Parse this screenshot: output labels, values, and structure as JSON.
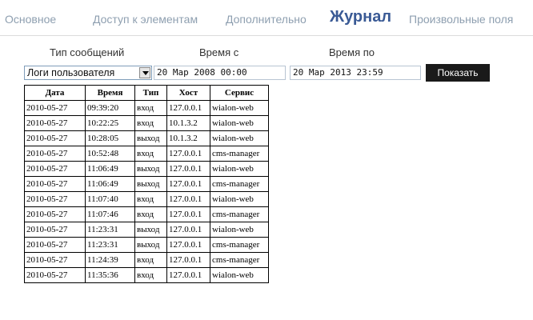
{
  "tabs": [
    {
      "label": "Основное"
    },
    {
      "label": "Доступ к элементам"
    },
    {
      "label": "Дополнительно"
    },
    {
      "label": "Журнал"
    },
    {
      "label": "Произвольные поля"
    }
  ],
  "active_tab": "Журнал",
  "filters": {
    "type_label": "Тип сообщений",
    "from_label": "Время с",
    "to_label": "Время по",
    "type_selected": "Логи пользователя",
    "from_value": "20 Мар 2008 00:00",
    "to_value": "20 Мар 2013 23:59",
    "show_button": "Показать"
  },
  "table": {
    "columns": [
      "Дата",
      "Время",
      "Тип",
      "Хост",
      "Сервис"
    ],
    "rows": [
      [
        "2010-05-27",
        "09:39:20",
        "вход",
        "127.0.0.1",
        "wialon-web"
      ],
      [
        "2010-05-27",
        "10:22:25",
        "вход",
        "10.1.3.2",
        "wialon-web"
      ],
      [
        "2010-05-27",
        "10:28:05",
        "выход",
        "10.1.3.2",
        "wialon-web"
      ],
      [
        "2010-05-27",
        "10:52:48",
        "вход",
        "127.0.0.1",
        "cms-manager"
      ],
      [
        "2010-05-27",
        "11:06:49",
        "выход",
        "127.0.0.1",
        "wialon-web"
      ],
      [
        "2010-05-27",
        "11:06:49",
        "выход",
        "127.0.0.1",
        "cms-manager"
      ],
      [
        "2010-05-27",
        "11:07:40",
        "вход",
        "127.0.0.1",
        "wialon-web"
      ],
      [
        "2010-05-27",
        "11:07:46",
        "вход",
        "127.0.0.1",
        "cms-manager"
      ],
      [
        "2010-05-27",
        "11:23:31",
        "выход",
        "127.0.0.1",
        "wialon-web"
      ],
      [
        "2010-05-27",
        "11:23:31",
        "выход",
        "127.0.0.1",
        "cms-manager"
      ],
      [
        "2010-05-27",
        "11:24:39",
        "вход",
        "127.0.0.1",
        "cms-manager"
      ],
      [
        "2010-05-27",
        "11:35:36",
        "вход",
        "127.0.0.1",
        "wialon-web"
      ]
    ]
  },
  "colors": {
    "tab_inactive": "#8e9fb0",
    "tab_active": "#3a5a95",
    "button_bg": "#1a1a1a"
  }
}
